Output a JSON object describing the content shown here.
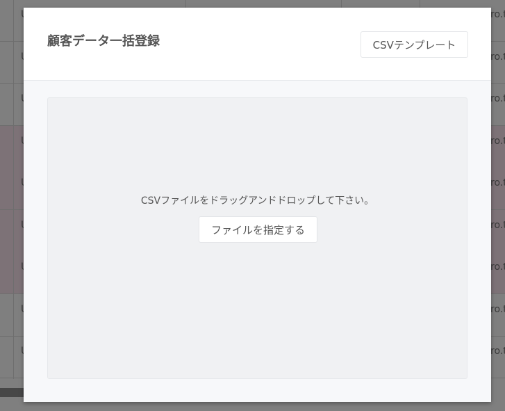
{
  "background_table": {
    "rows": [
      {
        "c1": "U",
        "c2": "ro.t",
        "highlight": false
      },
      {
        "c1": "U",
        "c2": "ro.t",
        "highlight": false
      },
      {
        "c1": "U",
        "c2": "ro.t",
        "highlight": false
      },
      {
        "c1": "U",
        "c2": "ro.t",
        "highlight": true
      },
      {
        "c1": "U",
        "c2": "ro.t",
        "highlight": true
      },
      {
        "c1": "U",
        "c2": "ro.t",
        "highlight": true
      },
      {
        "c1": "U",
        "c2": "ro.t",
        "highlight": true
      },
      {
        "c1": "U",
        "c2": "ro.t",
        "highlight": false
      },
      {
        "c1": "U",
        "c2": "ro.t",
        "highlight": false
      }
    ]
  },
  "modal": {
    "title": "顧客データ一括登録",
    "template_button": "CSVテンプレート",
    "dropzone_text": "CSVファイルをドラッグアンドドロップして下さい。",
    "file_button": "ファイルを指定する"
  }
}
